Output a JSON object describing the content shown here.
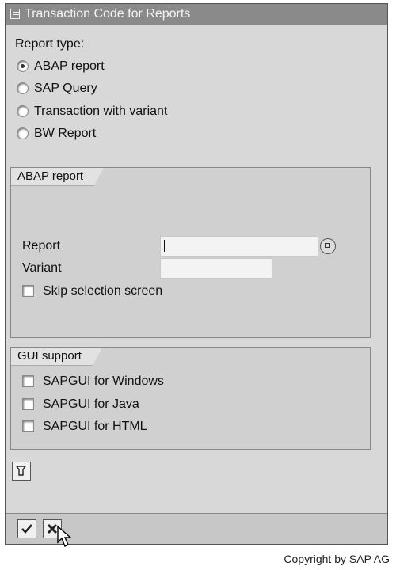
{
  "window": {
    "title": "Transaction Code for Reports"
  },
  "report_type": {
    "heading": "Report type:",
    "options": [
      {
        "label": "ABAP report",
        "selected": true
      },
      {
        "label": "SAP Query",
        "selected": false
      },
      {
        "label": "Transaction with variant",
        "selected": false
      },
      {
        "label": "BW Report",
        "selected": false
      }
    ]
  },
  "abap_group": {
    "title": "ABAP report",
    "report_label": "Report",
    "report_value": "",
    "variant_label": "Variant",
    "variant_value": "",
    "skip_label": "Skip selection screen",
    "skip_checked": false
  },
  "gui_group": {
    "title": "GUI support",
    "options": [
      {
        "label": "SAPGUI for Windows",
        "checked": false
      },
      {
        "label": "SAPGUI for Java",
        "checked": false
      },
      {
        "label": "SAPGUI for HTML",
        "checked": false
      }
    ]
  },
  "copyright": "Copyright by SAP AG",
  "icons": {
    "title": "window-icon",
    "value_help": "value-help-icon",
    "param": "parameter-icon",
    "ok": "checkmark-icon",
    "cancel": "cancel-x-icon"
  }
}
